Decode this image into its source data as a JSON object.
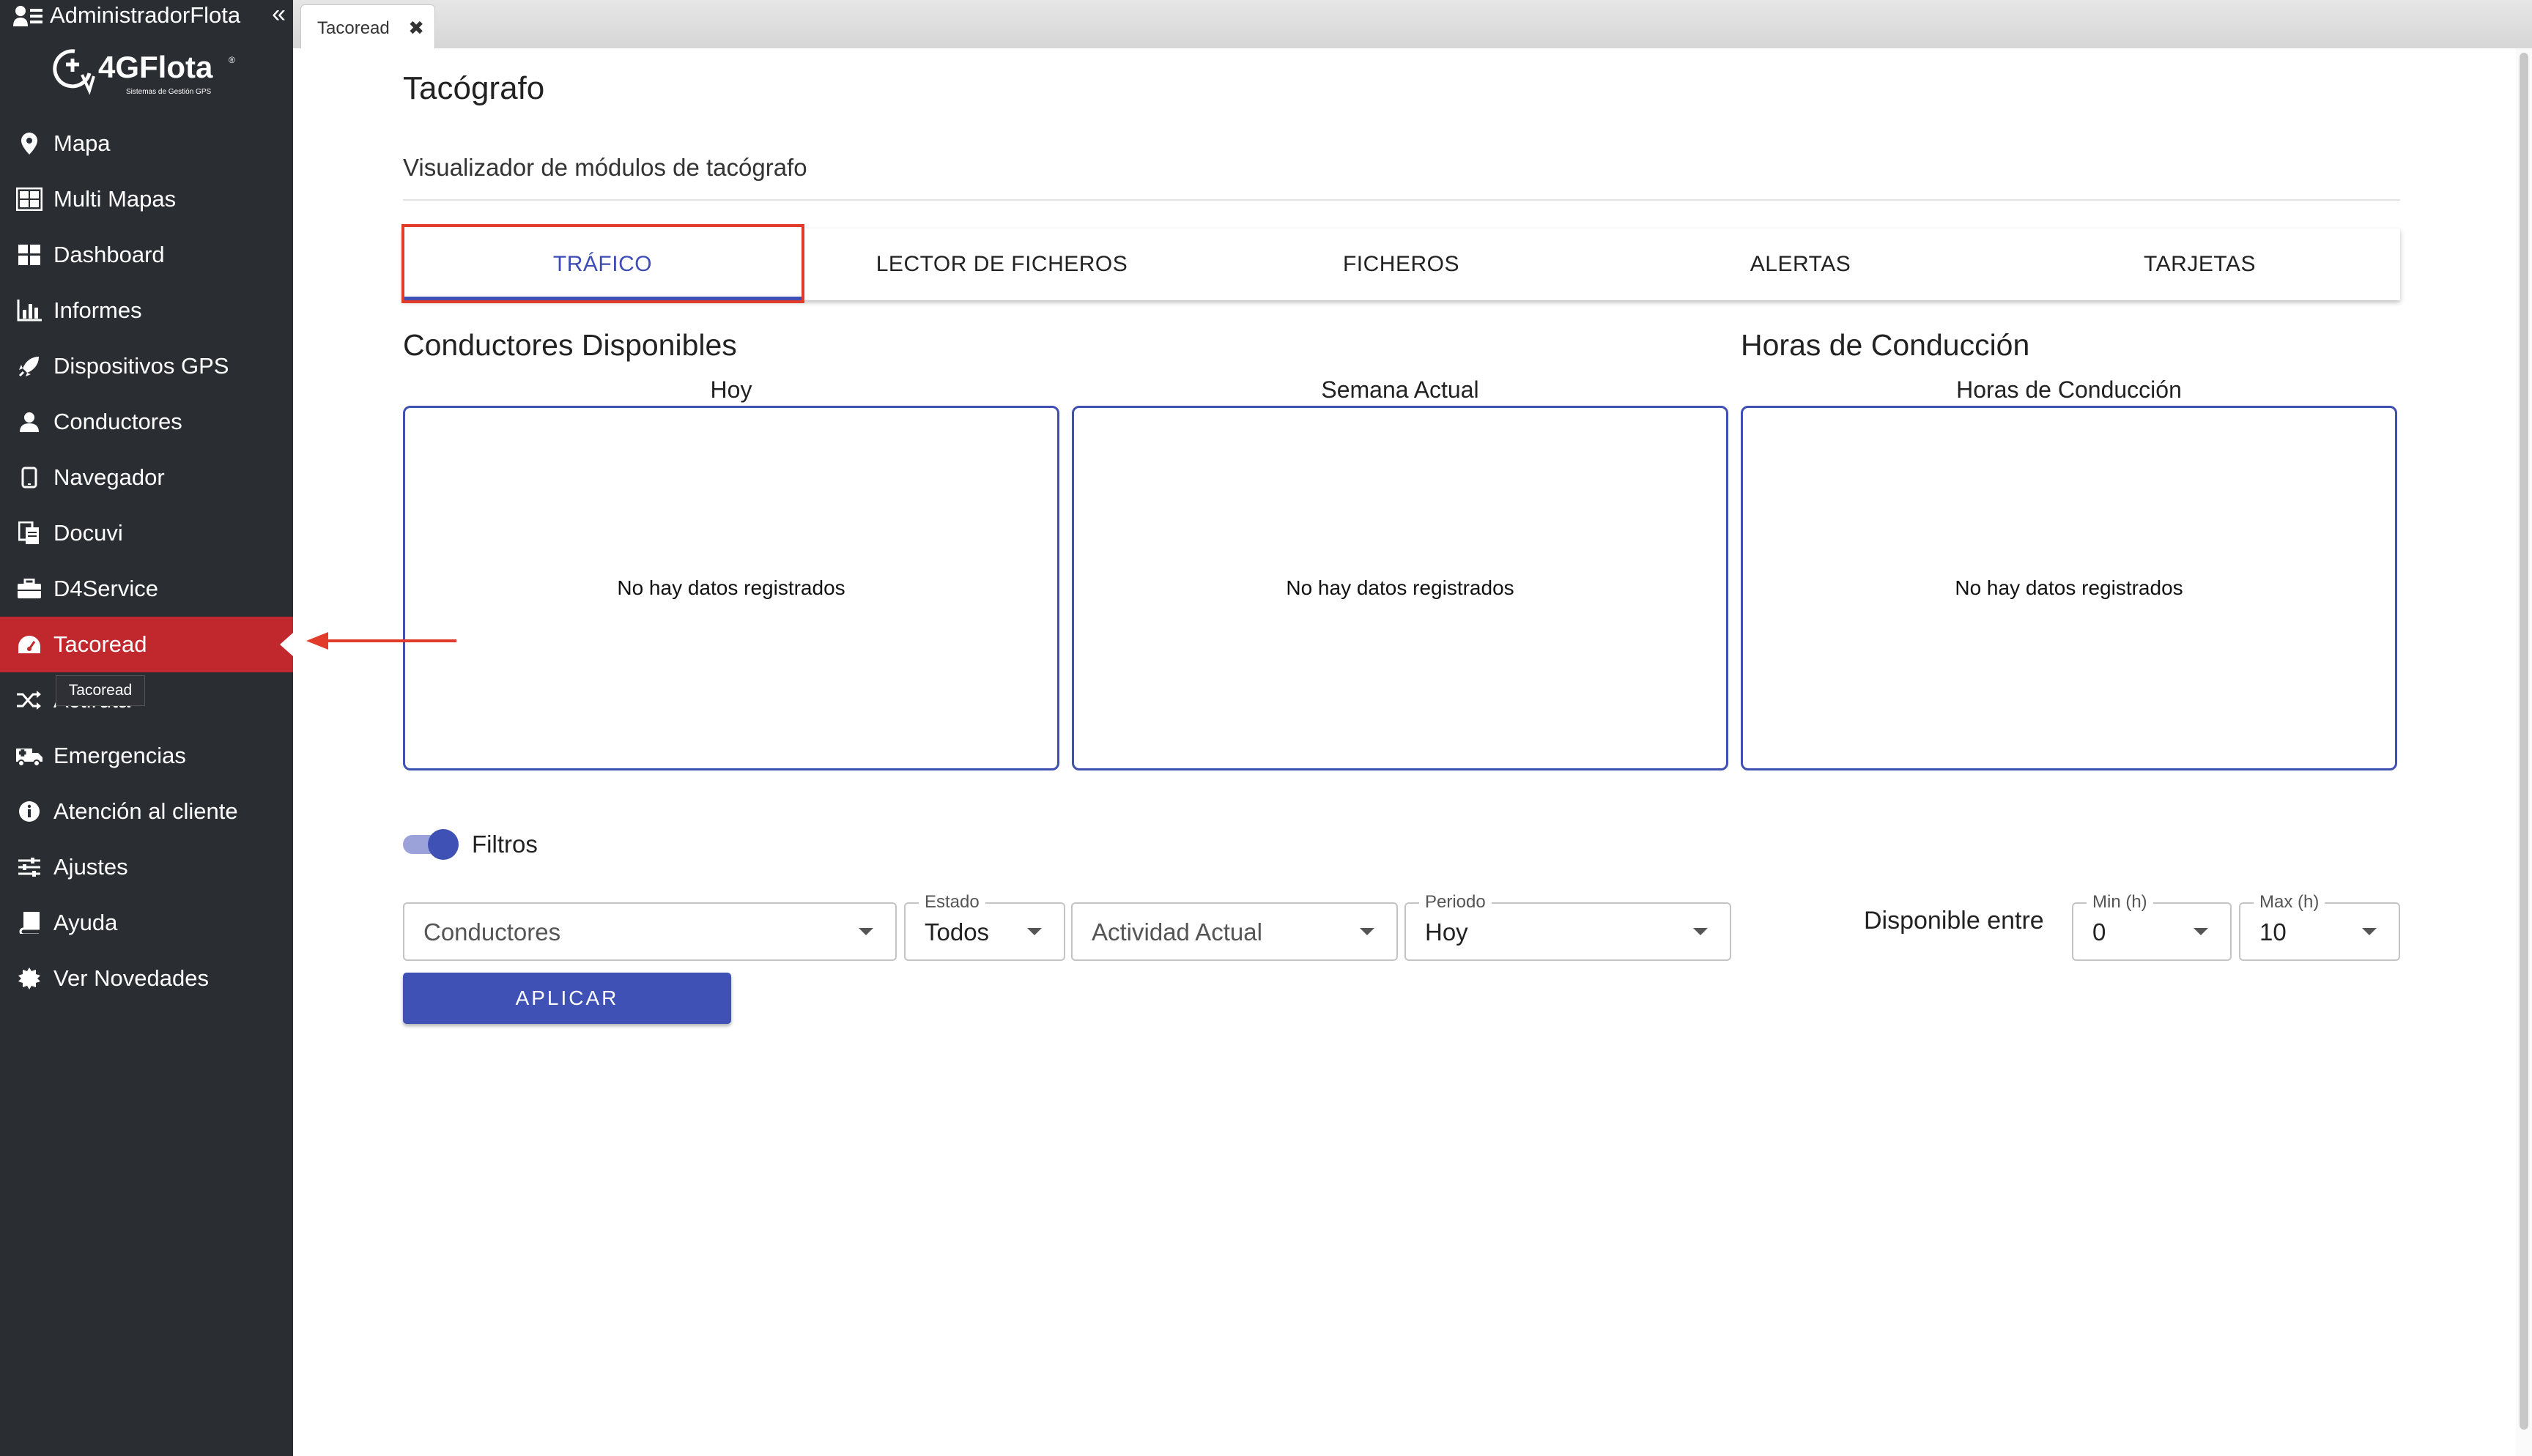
{
  "sidebar": {
    "user": "AdministradorFlota",
    "collapse_icon": "«",
    "logo": {
      "brand": "4GFlota",
      "registered": "®",
      "tagline": "Sistemas de Gestión GPS"
    },
    "items": [
      {
        "label": "Mapa",
        "icon": "map-marker-icon"
      },
      {
        "label": "Multi Mapas",
        "icon": "multi-map-icon"
      },
      {
        "label": "Dashboard",
        "icon": "dashboard-icon"
      },
      {
        "label": "Informes",
        "icon": "bar-chart-icon"
      },
      {
        "label": "Dispositivos GPS",
        "icon": "rocket-icon"
      },
      {
        "label": "Conductores",
        "icon": "user-icon"
      },
      {
        "label": "Navegador",
        "icon": "tablet-icon"
      },
      {
        "label": "Docuvi",
        "icon": "documents-icon"
      },
      {
        "label": "D4Service",
        "icon": "briefcase-icon"
      },
      {
        "label": "Tacoread",
        "icon": "tachometer-icon",
        "active": true
      },
      {
        "label": "Actiruta",
        "icon": "shuffle-icon"
      },
      {
        "label": "Emergencias",
        "icon": "ambulance-icon"
      },
      {
        "label": "Atención al cliente",
        "icon": "info-icon"
      },
      {
        "label": "Ajustes",
        "icon": "sliders-icon"
      },
      {
        "label": "Ayuda",
        "icon": "book-icon"
      },
      {
        "label": "Ver Novedades",
        "icon": "certificate-icon"
      }
    ],
    "tooltip": "Tacoread"
  },
  "doc_tab": {
    "label": "Tacoread",
    "close": "✖"
  },
  "page": {
    "title": "Tacógrafo",
    "subtitle": "Visualizador de módulos de tacógrafo"
  },
  "tabs": [
    "TRÁFICO",
    "LECTOR DE FICHEROS",
    "FICHEROS",
    "ALERTAS",
    "TARJETAS"
  ],
  "active_tab": "TRÁFICO",
  "sections": {
    "available_drivers": "Conductores Disponibles",
    "driving_hours": "Horas de Conducción"
  },
  "panels": [
    {
      "label": "Hoy",
      "empty": "No hay datos registrados"
    },
    {
      "label": "Semana Actual",
      "empty": "No hay datos registrados"
    },
    {
      "label": "Horas de Conducción",
      "empty": "No hay datos registrados"
    }
  ],
  "filters": {
    "toggle_label": "Filtros",
    "toggle_on": true,
    "conductores": {
      "placeholder": "Conductores"
    },
    "estado": {
      "legend": "Estado",
      "value": "Todos"
    },
    "actividad": {
      "placeholder": "Actividad Actual"
    },
    "periodo": {
      "legend": "Periodo",
      "value": "Hoy"
    },
    "available_between": "Disponible entre",
    "min": {
      "legend": "Min (h)",
      "value": "0"
    },
    "max": {
      "legend": "Max (h)",
      "value": "10"
    },
    "apply": "APLICAR"
  },
  "colors": {
    "sidebar_bg": "#2a2d32",
    "active_item": "#c0282d",
    "primary": "#3f51b5",
    "highlight": "#e23a2b"
  }
}
